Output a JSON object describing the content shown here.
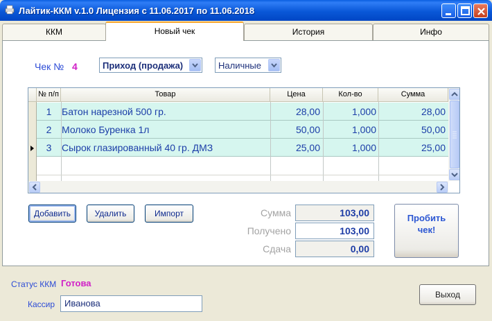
{
  "window": {
    "title": "Лайтик-ККМ v.1.0  Лицензия с 11.06.2017 по 11.06.2018"
  },
  "tabs": [
    {
      "label": "ККМ"
    },
    {
      "label": "Новый чек"
    },
    {
      "label": "История"
    },
    {
      "label": "Инфо"
    }
  ],
  "receipt": {
    "number_label": "Чек №",
    "number": "4",
    "operation_selected": "Приход (продажа)",
    "payment_selected": "Наличные"
  },
  "grid": {
    "columns": [
      "№ п/п",
      "Товар",
      "Цена",
      "Кол-во",
      "Сумма"
    ],
    "rows": [
      {
        "num": "1",
        "item": "Батон нарезной 500 гр.",
        "price": "28,00",
        "qty": "1,000",
        "sum": "28,00"
      },
      {
        "num": "2",
        "item": "Молоко Буренка 1л",
        "price": "50,00",
        "qty": "1,000",
        "sum": "50,00"
      },
      {
        "num": "3",
        "item": "Сырок глазированный 40 гр. ДМЗ",
        "price": "25,00",
        "qty": "1,000",
        "sum": "25,00"
      }
    ]
  },
  "actions": {
    "add": "Добавить",
    "delete": "Удалить",
    "import": "Импорт"
  },
  "totals": {
    "sum_label": "Сумма",
    "sum_value": "103,00",
    "received_label": "Получено",
    "received_value": "103,00",
    "change_label": "Сдача",
    "change_value": "0,00"
  },
  "print_button": {
    "line1": "Пробить",
    "line2": "чек!"
  },
  "status": {
    "label": "Статус ККМ",
    "value": "Готова"
  },
  "cashier": {
    "label": "Кассир",
    "value": "Иванова"
  },
  "exit_label": "Выход",
  "colors": {
    "label_blue": "#2c4bd6",
    "accent_magenta": "#d021c7",
    "row_bg": "#d6f6ef",
    "titlebar": "#0a58d8"
  }
}
